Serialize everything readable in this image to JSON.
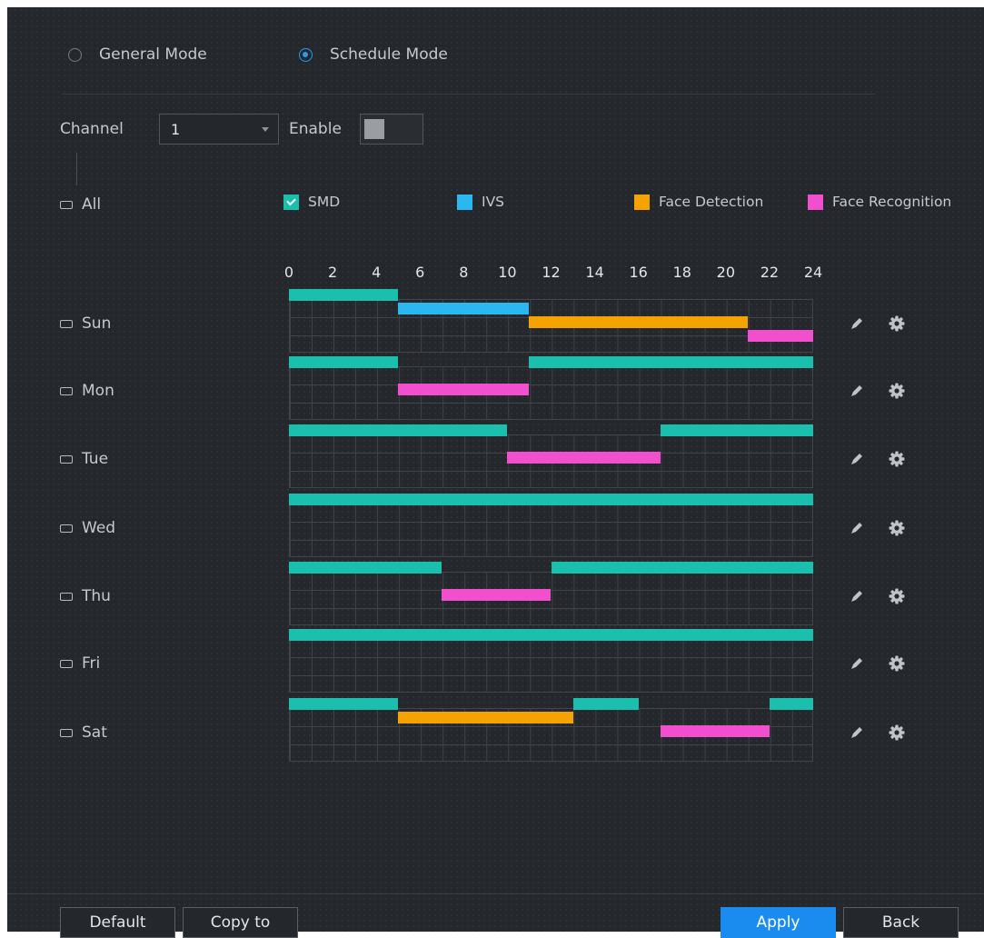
{
  "mode": {
    "general_label": "General Mode",
    "schedule_label": "Schedule Mode",
    "selected": "schedule"
  },
  "channel": {
    "label": "Channel",
    "value": "1"
  },
  "enable": {
    "label": "Enable",
    "on": false
  },
  "all_label": "All",
  "legend": [
    {
      "key": "smd",
      "label": "SMD",
      "color": "#1bbfad",
      "checked": true
    },
    {
      "key": "ivs",
      "label": "IVS",
      "color": "#2bb7f0",
      "checked": false
    },
    {
      "key": "face",
      "label": "Face Detection",
      "color": "#f4a300",
      "checked": false
    },
    {
      "key": "facerec",
      "label": "Face Recognition",
      "color": "#f24fce",
      "checked": false
    }
  ],
  "hour_ticks": [
    "0",
    "2",
    "4",
    "6",
    "8",
    "10",
    "12",
    "14",
    "16",
    "18",
    "20",
    "22",
    "24"
  ],
  "days": [
    {
      "label": "Sun",
      "rows": [
        [
          {
            "type": "smd",
            "start": 0,
            "end": 5
          }
        ],
        [
          {
            "type": "ivs",
            "start": 5,
            "end": 11
          }
        ],
        [
          {
            "type": "face",
            "start": 11,
            "end": 21
          }
        ],
        [
          {
            "type": "facerec",
            "start": 21,
            "end": 24
          }
        ]
      ]
    },
    {
      "label": "Mon",
      "rows": [
        [
          {
            "type": "smd",
            "start": 0,
            "end": 5
          },
          {
            "type": "smd",
            "start": 11,
            "end": 24
          }
        ],
        [],
        [
          {
            "type": "facerec",
            "start": 5,
            "end": 11
          }
        ],
        []
      ]
    },
    {
      "label": "Tue",
      "rows": [
        [
          {
            "type": "smd",
            "start": 0,
            "end": 10
          },
          {
            "type": "smd",
            "start": 17,
            "end": 24
          }
        ],
        [],
        [
          {
            "type": "facerec",
            "start": 10,
            "end": 17
          }
        ],
        []
      ]
    },
    {
      "label": "Wed",
      "rows": [
        [
          {
            "type": "smd",
            "start": 0,
            "end": 24
          }
        ],
        [],
        [],
        []
      ]
    },
    {
      "label": "Thu",
      "rows": [
        [
          {
            "type": "smd",
            "start": 0,
            "end": 7
          },
          {
            "type": "smd",
            "start": 12,
            "end": 24
          }
        ],
        [],
        [
          {
            "type": "facerec",
            "start": 7,
            "end": 12
          }
        ],
        []
      ]
    },
    {
      "label": "Fri",
      "rows": [
        [
          {
            "type": "smd",
            "start": 0,
            "end": 24
          }
        ],
        [],
        [],
        []
      ]
    },
    {
      "label": "Sat",
      "rows": [
        [
          {
            "type": "smd",
            "start": 0,
            "end": 5
          },
          {
            "type": "smd",
            "start": 13,
            "end": 16
          },
          {
            "type": "smd",
            "start": 22,
            "end": 24
          }
        ],
        [
          {
            "type": "face",
            "start": 5,
            "end": 13
          }
        ],
        [
          {
            "type": "facerec",
            "start": 17,
            "end": 22
          }
        ],
        []
      ]
    }
  ],
  "row_icons": {
    "edit": "pencil-icon",
    "settings": "gear-icon"
  },
  "buttons": {
    "default": "Default",
    "copy": "Copy to",
    "apply": "Apply",
    "back": "Back"
  }
}
